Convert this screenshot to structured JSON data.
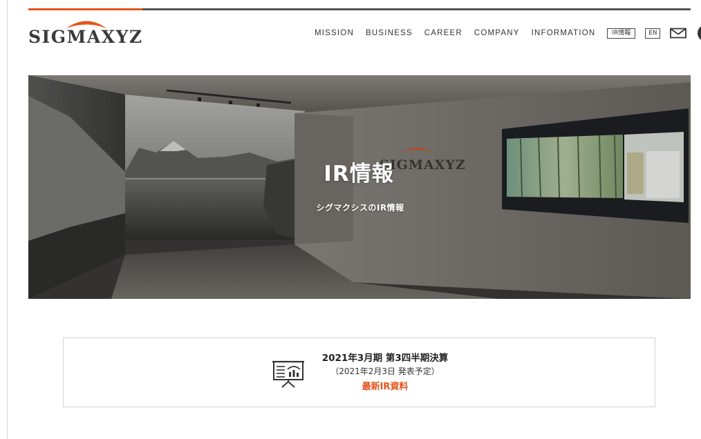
{
  "header": {
    "logo_text": "SIGMAXYZ",
    "nav": [
      {
        "label": "MISSION"
      },
      {
        "label": "BUSINESS"
      },
      {
        "label": "CAREER"
      },
      {
        "label": "COMPANY"
      },
      {
        "label": "INFORMATION"
      }
    ],
    "ir_label": "IR情報",
    "lang_label": "EN",
    "mail_icon": "mail-icon",
    "menu_icon": "menu-icon"
  },
  "hero": {
    "title": "IR情報",
    "subtitle": "シグマクシスのIR情報",
    "wall_logo_text": "SIGMAXYZ"
  },
  "ir_card": {
    "icon": "presentation-chart-icon",
    "title": "2021年3月期 第3四半期決算",
    "date": "（2021年2月3日 発表予定）",
    "link_label": "最新IR資料"
  },
  "colors": {
    "accent": "#e5541b",
    "text": "#333333",
    "border": "#d4d4d4"
  }
}
